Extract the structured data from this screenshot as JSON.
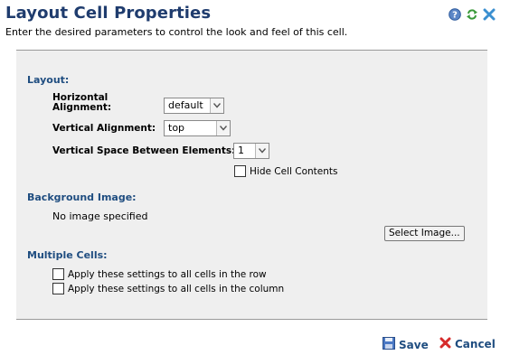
{
  "header": {
    "title": "Layout Cell Properties",
    "subtitle": "Enter the desired parameters to control the look and feel of this cell.",
    "icons": [
      "help-icon",
      "refresh-icon",
      "close-icon"
    ]
  },
  "layout": {
    "section_label": "Layout:",
    "horizontal_alignment_label_1": "Horizontal",
    "horizontal_alignment_label_2": "Alignment:",
    "horizontal_alignment_value": "default",
    "vertical_alignment_label": "Vertical Alignment:",
    "vertical_alignment_value": "top",
    "vertical_space_label": "Vertical Space Between Elements:",
    "vertical_space_value": "1",
    "hide_cell_contents_label": "Hide Cell Contents"
  },
  "background": {
    "section_label": "Background Image:",
    "status_text": "No image specified",
    "select_button_label": "Select Image..."
  },
  "multiple": {
    "section_label": "Multiple Cells:",
    "apply_row_label": "Apply these settings to all cells in the row",
    "apply_column_label": "Apply these settings to all cells in the column"
  },
  "footer": {
    "save_label": "Save",
    "cancel_label": "Cancel"
  },
  "colors": {
    "title": "#1f3c6e",
    "section": "#1f4d80",
    "panel_bg": "#efefef",
    "cancel_x": "#d62b2b"
  }
}
